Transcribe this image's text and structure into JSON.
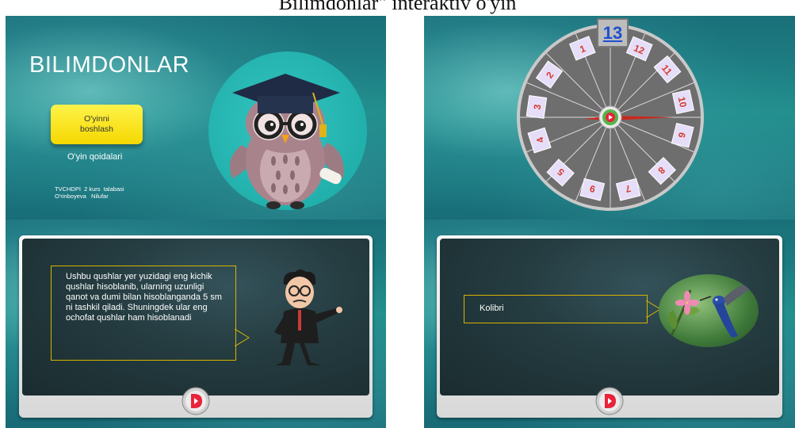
{
  "header": {
    "title": "Bilimdonlar\" interaktiv o'yin"
  },
  "slide1": {
    "title": "BILIMDONLAR",
    "start_button": "O'yinni boshlash",
    "rules_link": "O'yin  qoidalari",
    "credit_line1": "TVCHDPI  2 kurs  talabasi",
    "credit_line2": "O'rinboyeva   Nilufar"
  },
  "slide2": {
    "selected_number": "13",
    "wheel_numbers": [
      "1",
      "2",
      "3",
      "4",
      "5",
      "6",
      "7",
      "8",
      "9",
      "10",
      "11",
      "12"
    ],
    "center_icon": "play-logo-icon"
  },
  "slide3": {
    "question_text": "Ushbu qushlar yer yuzidagi eng kichik qushlar hisoblanib, ularning uzunligi qanot va dumi bilan hisoblanganda 5 sm ni tashkil qiladi. Shuningdek ular eng ochofat qushlar ham hisoblanadi",
    "character": "professor-cartoon"
  },
  "slide4": {
    "answer_text": "Kolibri",
    "image": "hummingbird-photo"
  },
  "colors": {
    "accent_yellow": "#f6de10",
    "teal": "#1f8a8a",
    "board_dark": "#243b3f",
    "play_red": "#e8233a"
  }
}
